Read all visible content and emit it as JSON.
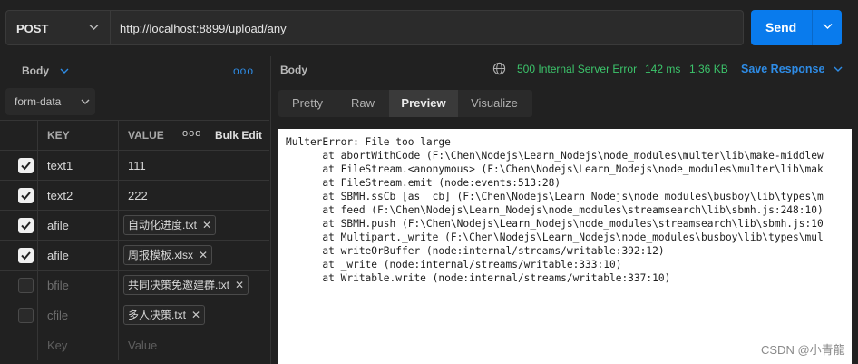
{
  "request": {
    "method": "POST",
    "url": "http://localhost:8899/upload/any",
    "send_label": "Send"
  },
  "left": {
    "body_tab": "Body",
    "body_type": "form-data",
    "columns": {
      "key": "KEY",
      "value": "VALUE",
      "bulk": "Bulk Edit"
    },
    "rows": [
      {
        "checked": true,
        "key": "text1",
        "value": "111"
      },
      {
        "checked": true,
        "key": "text2",
        "value": "222"
      },
      {
        "checked": true,
        "key": "afile",
        "file": "自动化进度.txt"
      },
      {
        "checked": true,
        "key": "afile",
        "file": "周报模板.xlsx"
      },
      {
        "checked": false,
        "key": "bfile",
        "file": "共同决策免邀建群.txt"
      },
      {
        "checked": false,
        "key": "cfile",
        "file": "多人决策.txt"
      }
    ],
    "placeholder_key": "Key",
    "placeholder_value": "Value"
  },
  "response": {
    "body_label": "Body",
    "status": "500 Internal Server Error",
    "time": "142 ms",
    "size": "1.36 KB",
    "save": "Save Response",
    "tabs": [
      "Pretty",
      "Raw",
      "Preview",
      "Visualize"
    ],
    "active_tab": "Preview",
    "body_text": "MulterError: File too large\n      at abortWithCode (F:\\Chen\\Nodejs\\Learn_Nodejs\\node_modules\\multer\\lib\\make-middlew\n      at FileStream.<anonymous> (F:\\Chen\\Nodejs\\Learn_Nodejs\\node_modules\\multer\\lib\\mak\n      at FileStream.emit (node:events:513:28)\n      at SBMH.ssCb [as _cb] (F:\\Chen\\Nodejs\\Learn_Nodejs\\node_modules\\busboy\\lib\\types\\m\n      at feed (F:\\Chen\\Nodejs\\Learn_Nodejs\\node_modules\\streamsearch\\lib\\sbmh.js:248:10)\n      at SBMH.push (F:\\Chen\\Nodejs\\Learn_Nodejs\\node_modules\\streamsearch\\lib\\sbmh.js:10\n      at Multipart._write (F:\\Chen\\Nodejs\\Learn_Nodejs\\node_modules\\busboy\\lib\\types\\mul\n      at writeOrBuffer (node:internal/streams/writable:392:12)\n      at _write (node:internal/streams/writable:333:10)\n      at Writable.write (node:internal/streams/writable:337:10)"
  },
  "watermark": "CSDN @小青龍",
  "colors": {
    "accent": "#097bed",
    "status_error": "#3cc46b",
    "link": "#2e8ce6"
  }
}
